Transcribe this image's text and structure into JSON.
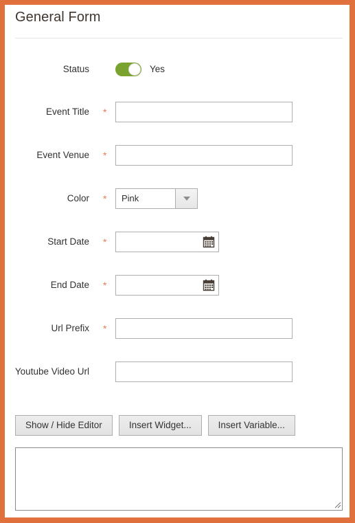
{
  "window": {
    "frame_color": "#e0703c",
    "panel_background": "#ffffff"
  },
  "form": {
    "title": "General Form",
    "required_marker": "*",
    "required_marker_color": "#e04f1a",
    "accent_toggle_color": "#79a22e",
    "fields": [
      {
        "id": "status",
        "label": "Status",
        "type": "toggle",
        "value": "Yes",
        "checked": true,
        "required": false
      },
      {
        "id": "event_title",
        "label": "Event Title",
        "type": "text",
        "value": "",
        "placeholder": "",
        "required": true
      },
      {
        "id": "event_venue",
        "label": "Event Venue",
        "type": "text",
        "value": "",
        "placeholder": "",
        "required": true
      },
      {
        "id": "color",
        "label": "Color",
        "type": "select",
        "value": "Pink",
        "required": true,
        "icon": "chevron-down-icon"
      },
      {
        "id": "start_date",
        "label": "Start Date",
        "type": "date",
        "value": "",
        "placeholder": "",
        "required": true,
        "icon": "calendar-icon"
      },
      {
        "id": "end_date",
        "label": "End Date",
        "type": "date",
        "value": "",
        "placeholder": "",
        "required": true,
        "icon": "calendar-icon"
      },
      {
        "id": "url_prefix",
        "label": "Url Prefix",
        "type": "text",
        "value": "",
        "placeholder": "",
        "required": true
      },
      {
        "id": "youtube_video_url",
        "label": "Youtube Video Url",
        "type": "text",
        "value": "",
        "placeholder": "",
        "required": false
      }
    ]
  },
  "editor": {
    "buttons": [
      {
        "id": "show-hide-editor",
        "label": "Show / Hide Editor"
      },
      {
        "id": "insert-widget",
        "label": "Insert Widget..."
      },
      {
        "id": "insert-variable",
        "label": "Insert Variable..."
      }
    ],
    "content": "",
    "placeholder": ""
  }
}
